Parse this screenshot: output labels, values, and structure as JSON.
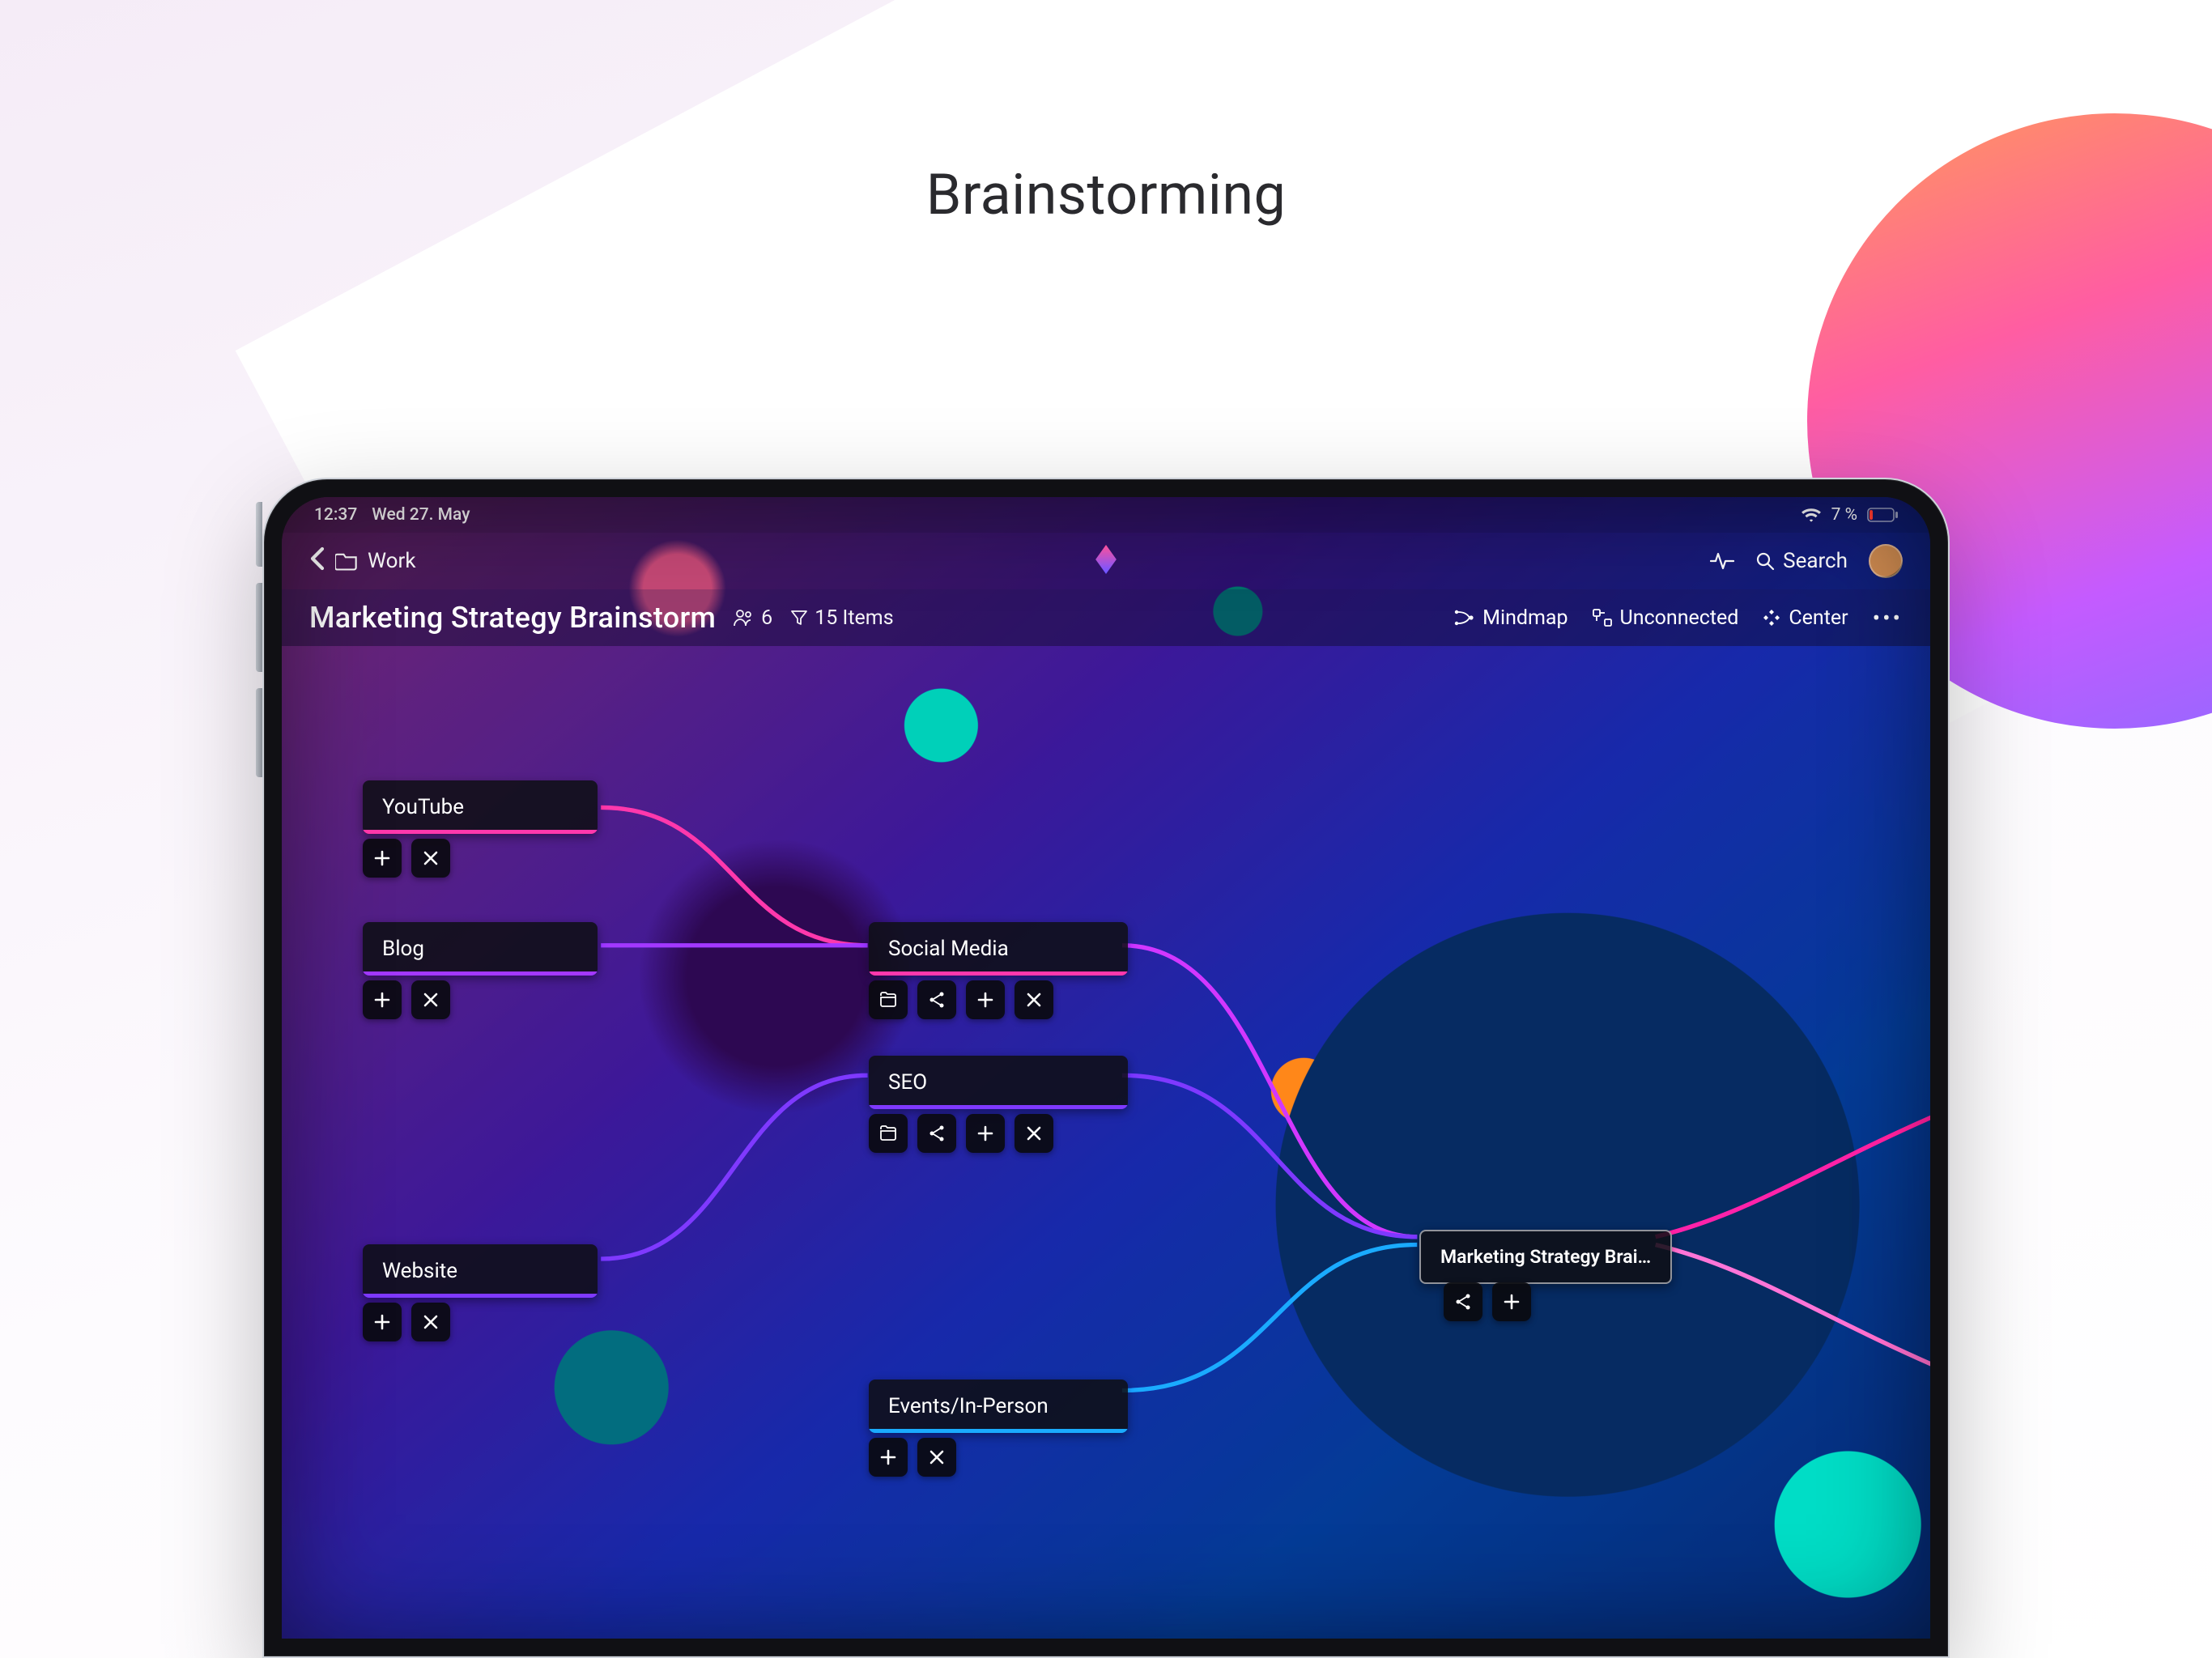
{
  "hero_title": "Brainstorming",
  "status": {
    "time": "12:37",
    "date": "Wed 27. May",
    "battery_percent": "7 %"
  },
  "nav": {
    "back_folder": "Work",
    "search_label": "Search"
  },
  "header": {
    "doc_title": "Marketing Strategy Brainstorm",
    "people_count": "6",
    "items_label": "15 Items",
    "mindmap_label": "Mindmap",
    "unconnected_label": "Unconnected",
    "center_label": "Center"
  },
  "nodes": {
    "youtube": "YouTube",
    "blog": "Blog",
    "website": "Website",
    "social_media": "Social Media",
    "seo": "SEO",
    "events": "Events/In-Person",
    "root": "Marketing Strategy Brai…"
  },
  "colors": {
    "pink": "#ff3fa4",
    "purple": "#7a3dff",
    "violet": "#9a3dff",
    "blue": "#2aa8ff",
    "hotpink": "#ff2aa0"
  }
}
